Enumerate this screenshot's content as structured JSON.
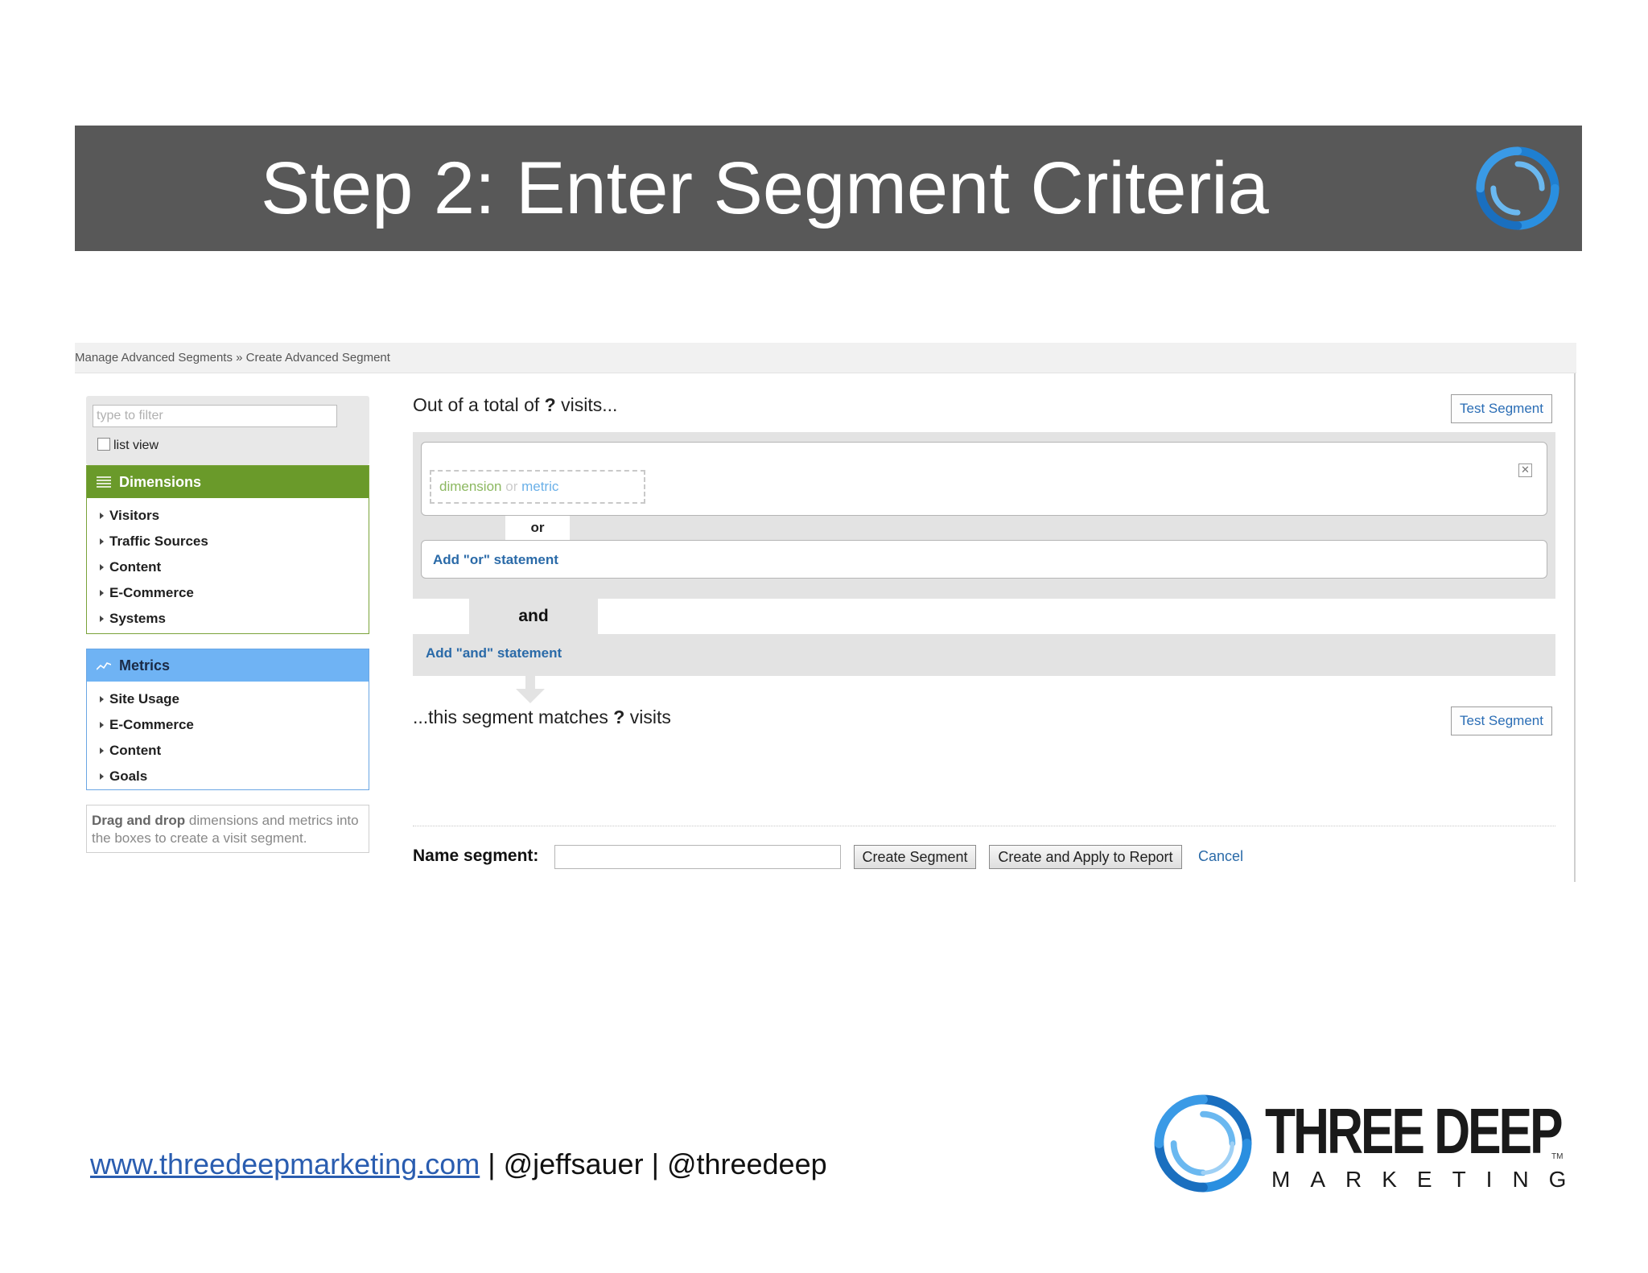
{
  "slide": {
    "title": "Step 2: Enter Segment Criteria"
  },
  "breadcrumb": {
    "text": "Manage Advanced Segments » Create Advanced Segment"
  },
  "sidebar": {
    "filter_placeholder": "type to filter",
    "list_view_label": "list view",
    "dimensions": {
      "heading": "Dimensions",
      "items": [
        "Visitors",
        "Traffic Sources",
        "Content",
        "E-Commerce",
        "Systems"
      ]
    },
    "metrics": {
      "heading": "Metrics",
      "items": [
        "Site Usage",
        "E-Commerce",
        "Content",
        "Goals"
      ]
    },
    "hint_bold": "Drag and drop",
    "hint_rest": "dimensions and metrics into the boxes to create a visit segment."
  },
  "main": {
    "top_question_prefix": "Out of a total of",
    "top_question_mark": "?",
    "top_question_suffix": "visits...",
    "test_segment_label": "Test Segment",
    "drop_dimension": "dimension",
    "drop_or": "or",
    "drop_metric": "metric",
    "close_glyph": "✕",
    "or_label": "or",
    "add_or_statement": "Add \"or\" statement",
    "and_label": "and",
    "add_and_statement": "Add \"and\" statement",
    "bottom_question_prefix": "...this segment matches",
    "bottom_question_mark": "?",
    "bottom_question_suffix": "visits",
    "name_segment_label": "Name segment:",
    "name_segment_value": "",
    "create_segment_label": "Create Segment",
    "create_apply_label": "Create and Apply to Report",
    "cancel_label": "Cancel"
  },
  "footer": {
    "website": "www.threedeepmarketing.com",
    "separator1": " | ",
    "handle1": "@jeffsauer",
    "separator2": " | ",
    "handle2": "@threedeep"
  },
  "brand": {
    "name": "THREE DEEP",
    "tm": "TM",
    "sub": "MARKETING"
  },
  "colors": {
    "title_band": "#585858",
    "dimensions_head": "#6a9a2a",
    "metrics_head": "#6fb3f4",
    "link_blue": "#2a6aa8",
    "logo_blue": "#1f7fd0"
  }
}
